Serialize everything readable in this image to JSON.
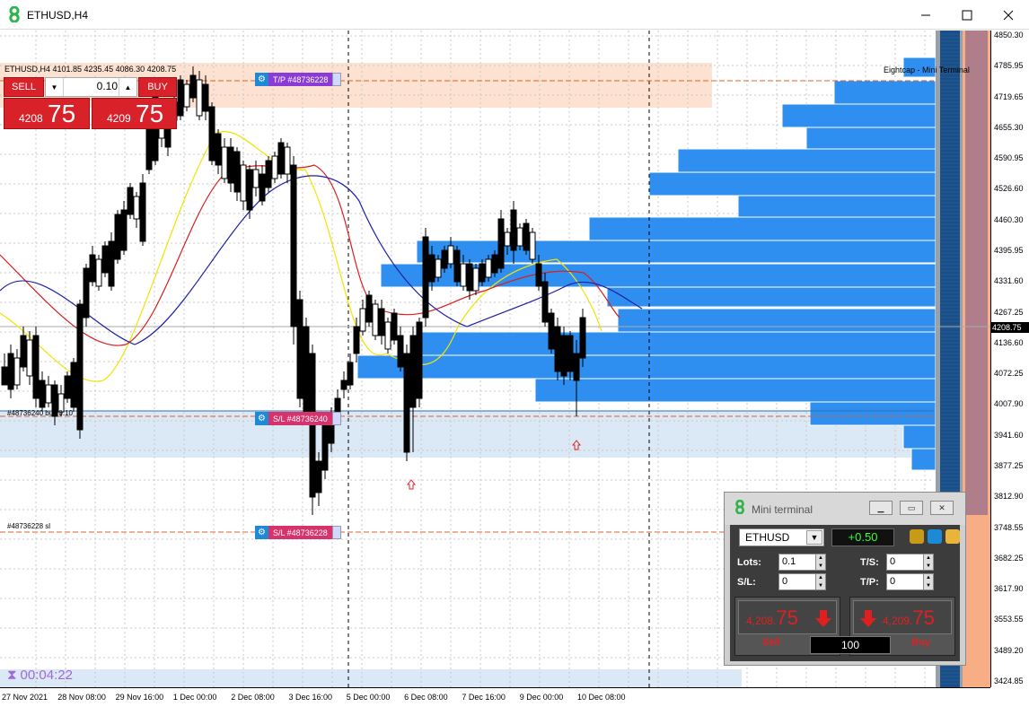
{
  "window": {
    "title": "ETHUSD,H4"
  },
  "chart": {
    "symbol_info": "ETHUSD,H4  4101.85 4235.45 4086.30 4208.75",
    "broker_label": "Eightcap - Mini Terminal",
    "current_price": "4208.75",
    "price_labels": [
      "4850.30",
      "4785.95",
      "4719.65",
      "4655.30",
      "4590.95",
      "4526.60",
      "4460.30",
      "4395.95",
      "4331.60",
      "4267.25",
      "4136.60",
      "4072.25",
      "4007.90",
      "3941.60",
      "3877.25",
      "3812.90",
      "3748.55",
      "3682.25",
      "3617.90",
      "3553.55",
      "3489.20",
      "3424.85"
    ],
    "time_labels": [
      "27 Nov 2021",
      "28 Nov 08:00",
      "29 Nov 16:00",
      "1 Dec 00:00",
      "2 Dec 08:00",
      "3 Dec 16:00",
      "5 Dec 00:00",
      "6 Dec 08:00",
      "7 Dec 16:00",
      "9 Dec 00:00",
      "10 Dec 08:00"
    ],
    "timer": "00:04:22",
    "order_buy_label": "#48736240 buy 0.10",
    "order_sl_label": "#48736228 sl",
    "tags": {
      "tp": "T/P #48736228",
      "sl1": "S/L #48736240",
      "sl2": "S/L #48736228"
    }
  },
  "one_click": {
    "sell_label": "SELL",
    "buy_label": "BUY",
    "lots": "0.10",
    "bid_small": "4208",
    "bid_big": "75",
    "ask_small": "4209",
    "ask_big": "75"
  },
  "mini_terminal": {
    "title": "Mini terminal",
    "symbol": "ETHUSD",
    "profit": "+0.50",
    "lots_label": "Lots:",
    "lots_value": "0.1",
    "sl_label": "S/L:",
    "sl_value": "0",
    "ts_label": "T/S:",
    "ts_value": "0",
    "tp_label": "T/P:",
    "tp_value": "0",
    "sell_price_small": "4,208.",
    "sell_price_big": "75",
    "buy_price_small": "4,209.",
    "buy_price_big": "75",
    "sell_label": "Sell",
    "buy_label": "Buy",
    "lots_box": "100"
  },
  "colors": {
    "bull": "#ffffff",
    "bear": "#000000",
    "volume_profile": "#2f8ff0",
    "ma_fast": "#f2e300",
    "ma_mid": "#d81f1f",
    "ma_slow": "#1d1fa8",
    "sl_zone": "#dbe8f5",
    "tp_zone": "#fde2d2",
    "tag_tp": "#8b3bd6",
    "tag_sl": "#d6336c"
  }
}
